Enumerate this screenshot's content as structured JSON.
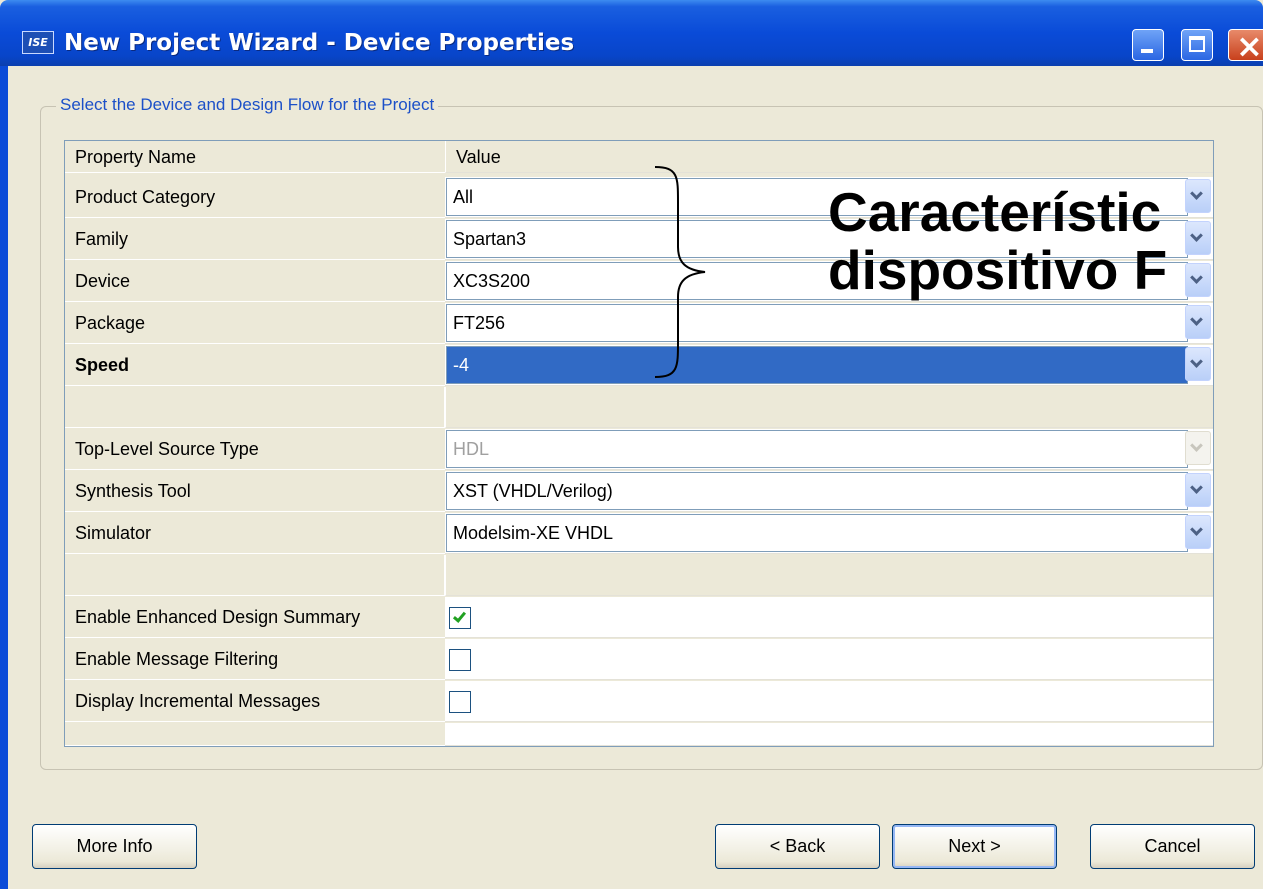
{
  "window": {
    "title": "New Project Wizard - Device Properties",
    "icon_text": "ISE"
  },
  "group": {
    "legend": "Select the Device and Design Flow for the Project"
  },
  "grid": {
    "header": {
      "name": "Property Name",
      "value": "Value"
    },
    "rows": [
      {
        "name": "Product Category",
        "value": "All"
      },
      {
        "name": "Family",
        "value": "Spartan3"
      },
      {
        "name": "Device",
        "value": "XC3S200"
      },
      {
        "name": "Package",
        "value": "FT256"
      },
      {
        "name": "Speed",
        "value": "-4"
      },
      {
        "name": "Top-Level Source Type",
        "value": "HDL"
      },
      {
        "name": "Synthesis Tool",
        "value": "XST (VHDL/Verilog)"
      },
      {
        "name": "Simulator",
        "value": "Modelsim-XE VHDL"
      },
      {
        "name": "Enable Enhanced Design Summary",
        "checked": true
      },
      {
        "name": "Enable Message Filtering",
        "checked": false
      },
      {
        "name": "Display Incremental Messages",
        "checked": false
      }
    ]
  },
  "annotation": {
    "line1": "Característic",
    "line2": "dispositivo F"
  },
  "buttons": {
    "more_info": "More Info",
    "back": "< Back",
    "next": "Next >",
    "cancel": "Cancel"
  },
  "colors": {
    "title_bar": "#0a4bd8",
    "selection": "#316ac5",
    "group_legend": "#1c50c8"
  }
}
